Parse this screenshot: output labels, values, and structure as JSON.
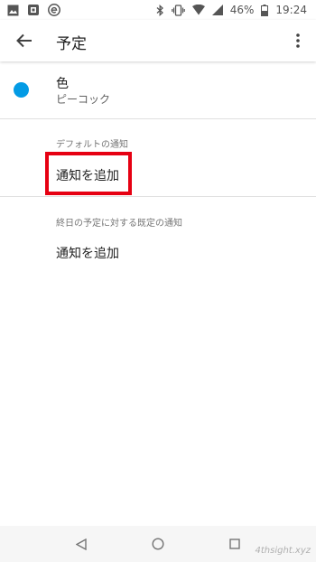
{
  "status_bar": {
    "battery": "46%",
    "time": "19:24"
  },
  "app_bar": {
    "title": "予定"
  },
  "color_setting": {
    "label": "色",
    "value": "ピーコック",
    "dot_color": "#039be5"
  },
  "default_notifications": {
    "header": "デフォルトの通知",
    "add_label": "通知を追加",
    "highlight_color": "#e60012"
  },
  "all_day_notifications": {
    "header": "終日の予定に対する既定の通知",
    "add_label": "通知を追加"
  },
  "watermark": "4thsight.xyz"
}
